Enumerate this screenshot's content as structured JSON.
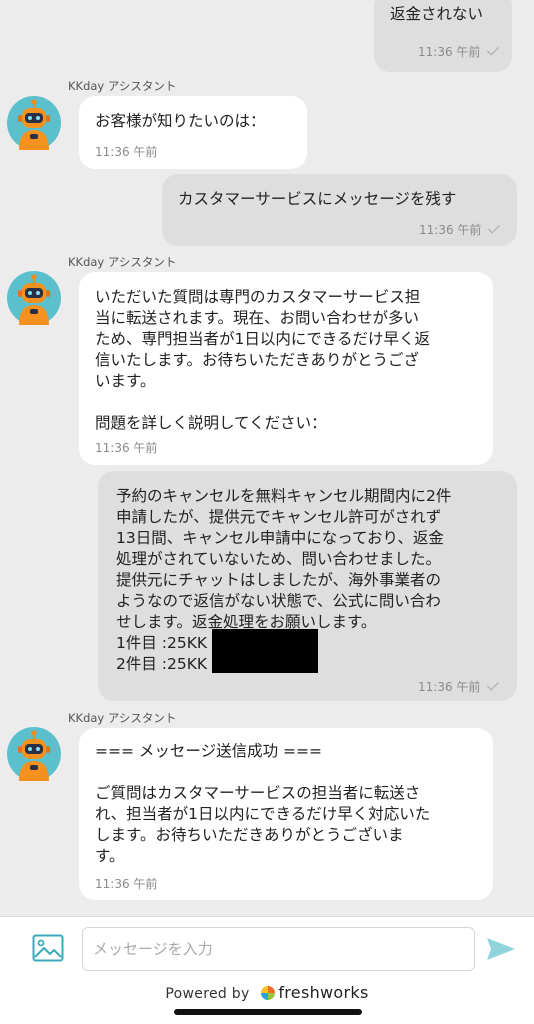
{
  "bot_name": "KKday アシスタント",
  "messages": [
    {
      "from": "user",
      "text": "返金されない",
      "time": "11:36 午前"
    },
    {
      "from": "bot",
      "text": "お客様が知りたいのは：",
      "time": "11:36 午前"
    },
    {
      "from": "user",
      "text": "カスタマーサービスにメッセージを残す",
      "time": "11:36 午前"
    },
    {
      "from": "bot",
      "text": "いただいた質問は専門のカスタマーサービス担\n当に転送されます。現在、お問い合わせが多い\nため、専門担当者が1日以内にできるだけ早く返\n信いたします。お待ちいただきありがとうござ\nいます。\n\n問題を詳しく説明してください：",
      "time": "11:36 午前"
    },
    {
      "from": "user",
      "text": "予約のキャンセルを無料キャンセル期間内に2件\n申請したが、提供元でキャンセル許可がされず\n13日間、キャンセル申請中になっており、返金\n処理がされていないため、問い合わせました。\n提供元にチャットはしましたが、海外事業者の\nようなので返信がない状態で、公式に問い合わ\nせします。返金処理をお願いします。\n1件目 :25KK\n2件目 :25KK",
      "time": "11:36 午前"
    },
    {
      "from": "bot",
      "text": "=== メッセージ送信成功 ===\n\nご質問はカスタマーサービスの担当者に転送さ\nれ、担当者が1日以内にできるだけ早く対応いた\nします。お待ちいただきありがとうございま\nす。",
      "time": "11:36 午前"
    }
  ],
  "composer": {
    "placeholder": "メッセージを入力"
  },
  "footer": {
    "powered_by": "Powered by",
    "brand": "freshworks"
  },
  "colors": {
    "bot_bubble": "#ffffff",
    "user_bubble": "#dedede",
    "send_icon": "#8fd3dd",
    "avatar_bg": "#5bc0cc"
  },
  "icons": {
    "attach": "image-icon",
    "send": "send-icon",
    "avatar": "robot-avatar-icon"
  }
}
